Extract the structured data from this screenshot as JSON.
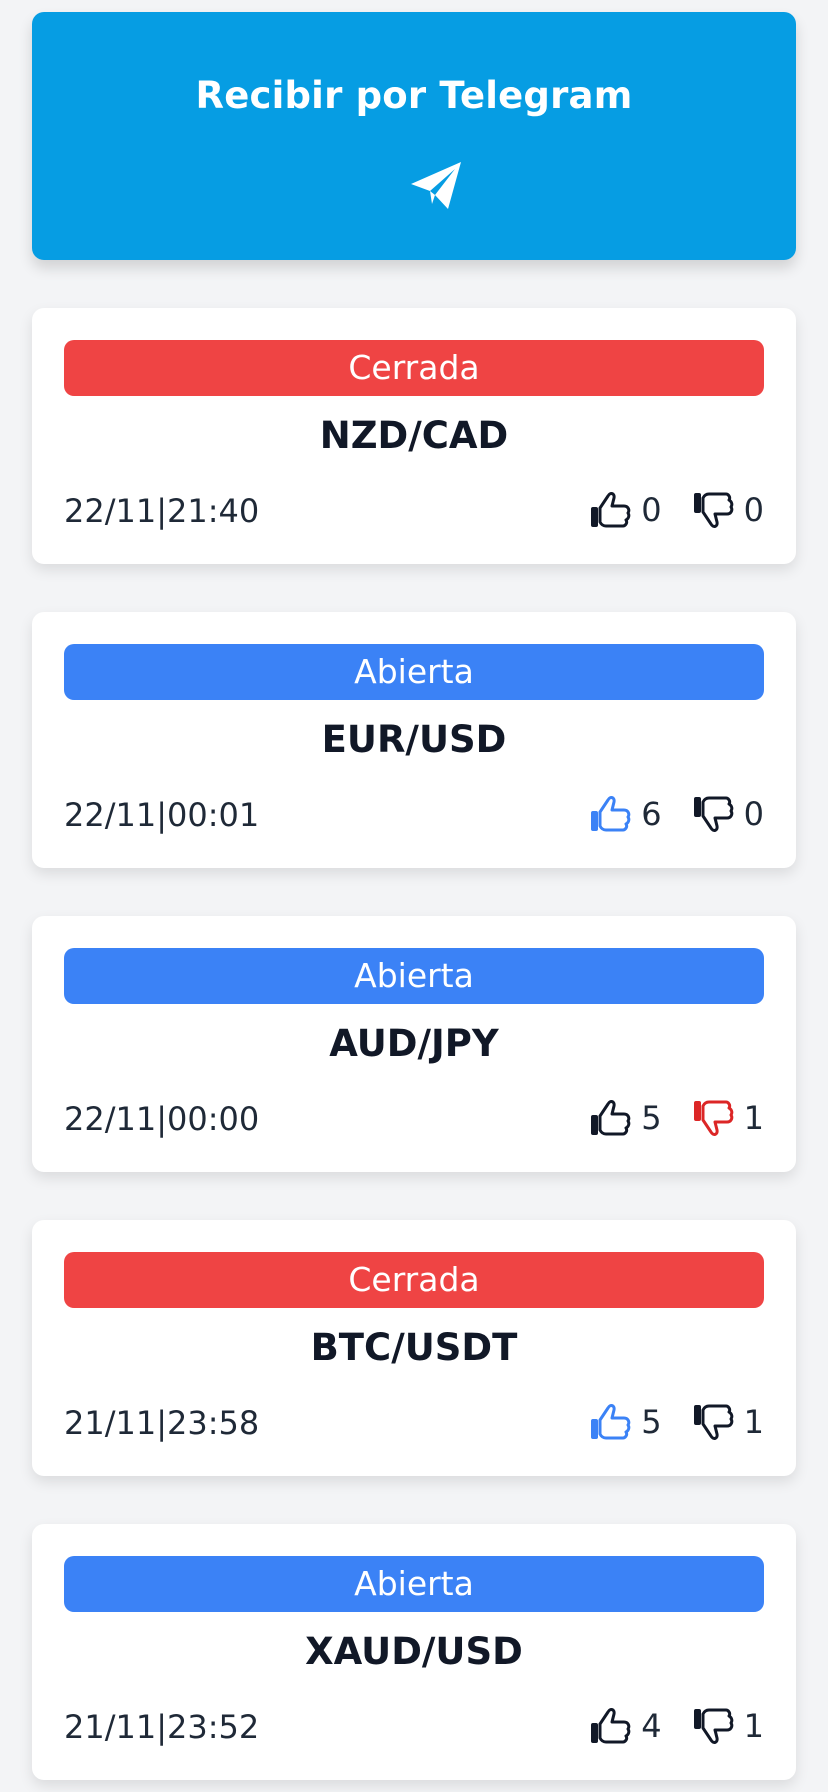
{
  "telegram": {
    "label": "Recibir por Telegram",
    "icon": "paper-plane-icon"
  },
  "colors": {
    "telegram_bg": "#069de3",
    "closed": "#ef4444",
    "open": "#3b82f6",
    "like_active": "#3b82f6",
    "dislike_active": "#dc2626",
    "inactive": "#111827"
  },
  "signals": [
    {
      "status": "Cerrada",
      "pair": "NZD/CAD",
      "datetime": "22/11|21:40",
      "likes": "0",
      "dislikes": "0",
      "like_active": false,
      "dislike_active": false
    },
    {
      "status": "Abierta",
      "pair": "EUR/USD",
      "datetime": "22/11|00:01",
      "likes": "6",
      "dislikes": "0",
      "like_active": true,
      "dislike_active": false
    },
    {
      "status": "Abierta",
      "pair": "AUD/JPY",
      "datetime": "22/11|00:00",
      "likes": "5",
      "dislikes": "1",
      "like_active": false,
      "dislike_active": true
    },
    {
      "status": "Cerrada",
      "pair": "BTC/USDT",
      "datetime": "21/11|23:58",
      "likes": "5",
      "dislikes": "1",
      "like_active": true,
      "dislike_active": false
    },
    {
      "status": "Abierta",
      "pair": "XAUD/USD",
      "datetime": "21/11|23:52",
      "likes": "4",
      "dislikes": "1",
      "like_active": false,
      "dislike_active": false
    }
  ]
}
